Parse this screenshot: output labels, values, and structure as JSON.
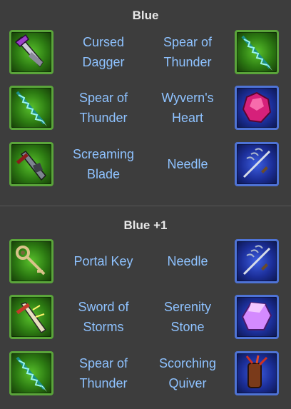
{
  "sections": [
    {
      "title": "Blue",
      "rows": [
        {
          "left": {
            "name": "Cursed Dagger",
            "icon": "cursed-dagger-icon",
            "rarity": "green"
          },
          "right": {
            "name": "Spear of Thunder",
            "icon": "spear-of-thunder-icon",
            "rarity": "green"
          }
        },
        {
          "left": {
            "name": "Spear of Thunder",
            "icon": "spear-of-thunder-icon",
            "rarity": "green"
          },
          "right": {
            "name": "Wyvern's Heart",
            "icon": "wyverns-heart-icon",
            "rarity": "blue"
          }
        },
        {
          "left": {
            "name": "Screaming Blade",
            "icon": "screaming-blade-icon",
            "rarity": "green"
          },
          "right": {
            "name": "Needle",
            "icon": "needle-icon",
            "rarity": "blue"
          }
        }
      ]
    },
    {
      "title": "Blue +1",
      "rows": [
        {
          "left": {
            "name": "Portal Key",
            "icon": "portal-key-icon",
            "rarity": "green"
          },
          "right": {
            "name": "Needle",
            "icon": "needle-icon",
            "rarity": "blue"
          }
        },
        {
          "left": {
            "name": "Sword of Storms",
            "icon": "sword-of-storms-icon",
            "rarity": "green"
          },
          "right": {
            "name": "Serenity Stone",
            "icon": "serenity-stone-icon",
            "rarity": "blue"
          }
        },
        {
          "left": {
            "name": "Spear of Thunder",
            "icon": "spear-of-thunder-icon",
            "rarity": "green"
          },
          "right": {
            "name": "Scorching Quiver",
            "icon": "scorching-quiver-icon",
            "rarity": "blue"
          }
        }
      ]
    }
  ],
  "colors": {
    "background": "#3d3d3d",
    "title": "#e8e8e8",
    "item_name": "#8ec2ff",
    "green_frame": "#5aa53a",
    "blue_frame": "#4e73d6"
  }
}
